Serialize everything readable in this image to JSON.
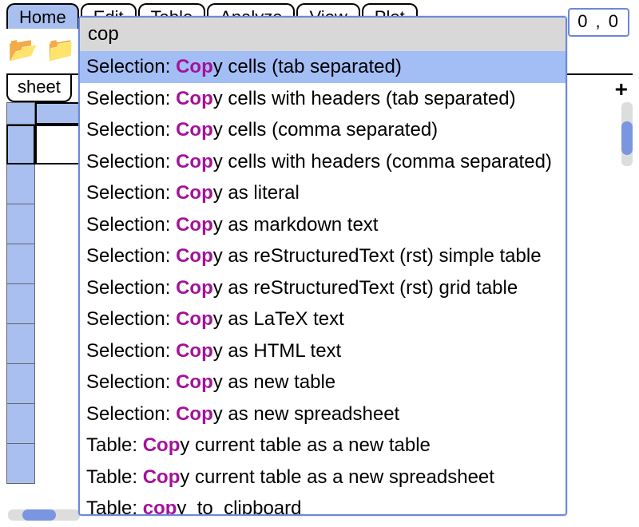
{
  "ribbon": {
    "tabs": [
      "Home",
      "Edit",
      "Table",
      "Analyze",
      "View",
      "Plot"
    ],
    "active_index": 0
  },
  "cursor_position": "0 , 0",
  "toolbar_icons": [
    "open-tab-icon",
    "open-sheet-icon",
    "tool3-icon",
    "tool4-icon",
    "tool5-icon",
    "tool6-icon",
    "tool7-icon"
  ],
  "sheet_tabs": [
    "sheet"
  ],
  "add_sheet_label": "+",
  "palette": {
    "query": "cop",
    "items": [
      {
        "prefix": "Selection: ",
        "match": "Cop",
        "rest": "y cells (tab separated)",
        "selected": true
      },
      {
        "prefix": "Selection: ",
        "match": "Cop",
        "rest": "y cells with headers (tab separated)"
      },
      {
        "prefix": "Selection: ",
        "match": "Cop",
        "rest": "y cells (comma separated)"
      },
      {
        "prefix": "Selection: ",
        "match": "Cop",
        "rest": "y cells with headers (comma separated)"
      },
      {
        "prefix": "Selection: ",
        "match": "Cop",
        "rest": "y as literal"
      },
      {
        "prefix": "Selection: ",
        "match": "Cop",
        "rest": "y as markdown text"
      },
      {
        "prefix": "Selection: ",
        "match": "Cop",
        "rest": "y as reStructuredText (rst) simple table"
      },
      {
        "prefix": "Selection: ",
        "match": "Cop",
        "rest": "y as reStructuredText (rst) grid table"
      },
      {
        "prefix": "Selection: ",
        "match": "Cop",
        "rest": "y as LaTeX text"
      },
      {
        "prefix": "Selection: ",
        "match": "Cop",
        "rest": "y as HTML text"
      },
      {
        "prefix": "Selection: ",
        "match": "Cop",
        "rest": "y as new table"
      },
      {
        "prefix": "Selection: ",
        "match": "Cop",
        "rest": "y as new spreadsheet"
      },
      {
        "prefix": "Table: ",
        "match": "Cop",
        "rest": "y current table as a new table"
      },
      {
        "prefix": "Table: ",
        "match": "Cop",
        "rest": "y current table as a new spreadsheet"
      },
      {
        "prefix": "Table: ",
        "match": "cop",
        "rest": "y_to_clipboard",
        "lower": true
      }
    ]
  }
}
